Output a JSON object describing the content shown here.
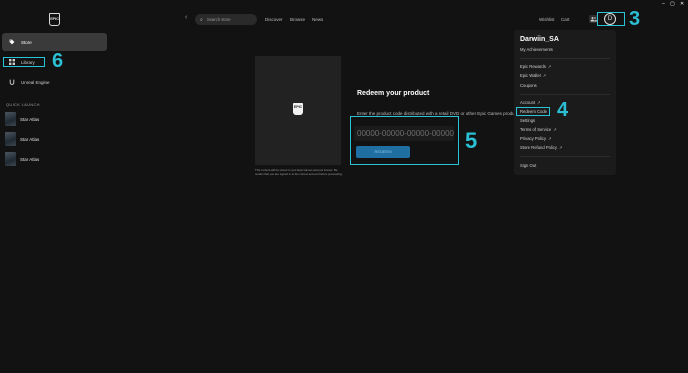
{
  "app": {
    "logo_text": "EPIC"
  },
  "sidebar": {
    "store_label": "Store",
    "library_label": "Library",
    "unreal_label": "Unreal Engine",
    "quick_launch_title": "QUICK LAUNCH",
    "quick_launch": [
      {
        "label": "Star Atlas"
      },
      {
        "label": "Star Atlas"
      },
      {
        "label": "Star Atlas"
      }
    ]
  },
  "topbar": {
    "back_icon": "‹",
    "search_placeholder": "Search store",
    "links": [
      "Discover",
      "Browse",
      "News"
    ],
    "wishlist": "Wishlist",
    "cart": "Cart",
    "avatar_initial": "D"
  },
  "window_controls": {
    "minimize": "–",
    "maximize": "▢",
    "close": "✕"
  },
  "main": {
    "art_caption": "This content will be stored in your Epic Games account forever. Be certain that you are signed in to the correct account before proceeding.",
    "redeem_title": "Redeem your product",
    "redeem_description": "Enter the product code distributed with a retail DVD or other Epic Games products.",
    "code_placeholder": "00000-00000-00000-00000",
    "redeem_button": "REDEEM"
  },
  "dropdown": {
    "username": "Darwiin_SA",
    "my_achievements": "My Achievements",
    "epic_rewards": "Epic Rewards",
    "epic_wallet": "Epic Wallet",
    "coupons": "Coupons",
    "account": "Account",
    "redeem_code": "Redeem Code",
    "settings": "Settings",
    "terms": "Terms of Service",
    "privacy": "Privacy Policy",
    "refund": "Store Refund Policy",
    "sign_out": "Sign Out",
    "external_icon": "↗"
  },
  "annotations": {
    "n3": "3",
    "n4": "4",
    "n5": "5",
    "n6": "6"
  },
  "colors": {
    "accent": "#29c3d6",
    "button": "#1f6fa3",
    "background": "#121212",
    "panel": "#1b1b1b"
  }
}
